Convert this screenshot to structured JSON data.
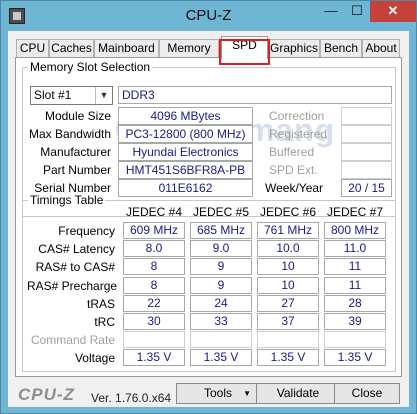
{
  "window": {
    "title": "CPU-Z",
    "min_label": "—",
    "max_label": "☐",
    "close_label": "✕"
  },
  "tabs": [
    "CPU",
    "Caches",
    "Mainboard",
    "Memory",
    "SPD",
    "Graphics",
    "Bench",
    "About"
  ],
  "active_tab": "SPD",
  "watermark": "uantrimang",
  "memory_slot": {
    "group_title": "Memory Slot Selection",
    "slot_selected": "Slot #1",
    "type": "DDR3",
    "labels": {
      "module_size": "Module Size",
      "max_bandwidth": "Max Bandwidth",
      "manufacturer": "Manufacturer",
      "part_number": "Part Number",
      "serial_number": "Serial Number"
    },
    "values": {
      "module_size": "4096 MBytes",
      "max_bandwidth": "PC3-12800 (800 MHz)",
      "manufacturer": "Hyundai Electronics",
      "part_number": "HMT451S6BFR8A-PB",
      "serial_number": "011E6162"
    },
    "right_labels": {
      "correction": "Correction",
      "registered": "Registered",
      "buffered": "Buffered",
      "spd_ext": "SPD Ext.",
      "week_year": "Week/Year"
    },
    "week_year": "20 / 15"
  },
  "timings": {
    "group_title": "Timings Table",
    "columns": [
      "JEDEC #4",
      "JEDEC #5",
      "JEDEC #6",
      "JEDEC #7"
    ],
    "rows": [
      {
        "label": "Frequency",
        "values": [
          "609 MHz",
          "685 MHz",
          "761 MHz",
          "800 MHz"
        ]
      },
      {
        "label": "CAS# Latency",
        "values": [
          "8.0",
          "9.0",
          "10.0",
          "11.0"
        ]
      },
      {
        "label": "RAS# to CAS#",
        "values": [
          "8",
          "9",
          "10",
          "11"
        ]
      },
      {
        "label": "RAS# Precharge",
        "values": [
          "8",
          "9",
          "10",
          "11"
        ]
      },
      {
        "label": "tRAS",
        "values": [
          "22",
          "24",
          "27",
          "28"
        ]
      },
      {
        "label": "tRC",
        "values": [
          "30",
          "33",
          "37",
          "39"
        ]
      },
      {
        "label": "Command Rate",
        "values": [
          "",
          "",
          "",
          ""
        ]
      },
      {
        "label": "Voltage",
        "values": [
          "1.35 V",
          "1.35 V",
          "1.35 V",
          "1.35 V"
        ]
      }
    ]
  },
  "bottom": {
    "brand": "CPU-Z",
    "version": "Ver. 1.76.0.x64",
    "tools_label": "Tools",
    "validate_label": "Validate",
    "close_label": "Close"
  },
  "colors": {
    "title_bar": "#6eb6d4",
    "value_text": "#1a1a8a",
    "highlight": "#e02020",
    "close_button": "#c7413b"
  }
}
